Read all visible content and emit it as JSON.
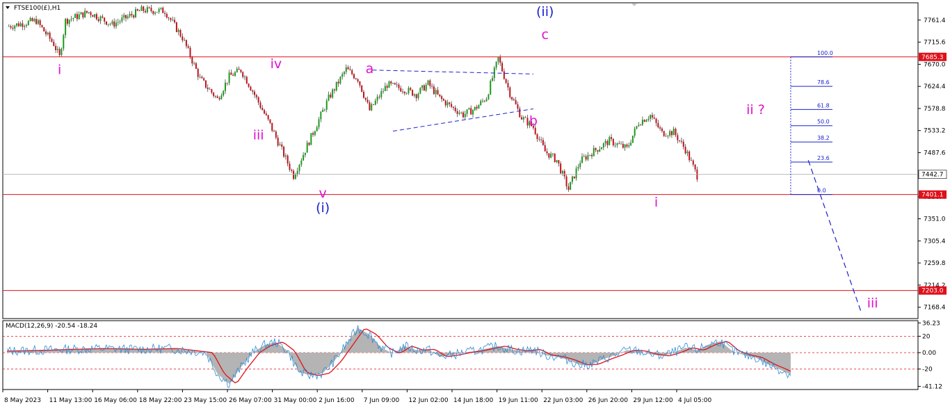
{
  "header": {
    "symbol": "FTSE100(£),H1",
    "macd_label": "MACD(12,26,9) -20.54 -18.24"
  },
  "colors": {
    "bull": "#1a9a1a",
    "bear": "#c0101a",
    "wick": "#2a2a2a",
    "level": "#e0101a",
    "wave_minor": "#e010d0",
    "wave_major": "#1a22cc",
    "fib": "#1a22cc",
    "macd_hist": "#b4b4b4",
    "macd_signal": "#e0101a",
    "macd_line": "#2a8ad6",
    "grid_border": "#000000"
  },
  "chart_data": [
    {
      "type": "candlestick",
      "title": "FTSE100(£),H1",
      "ylim": [
        7145,
        7797
      ],
      "y_ticks": [
        7761.4,
        7715.6,
        7670.0,
        7624.4,
        7578.8,
        7533.2,
        7487.6,
        7442.0,
        7396.4,
        7351.0,
        7305.4,
        7259.8,
        7214.2,
        7168.4
      ],
      "x_ticks": [
        "8 May 2023",
        "11 May 13:00",
        "16 May 06:00",
        "18 May 22:00",
        "23 May 15:00",
        "26 May 07:00",
        "31 May 00:00",
        "2 Jun 16:00",
        "7 Jun 09:00",
        "12 Jun 02:00",
        "14 Jun 18:00",
        "19 Jun 11:00",
        "22 Jun 03:00",
        "26 Jun 20:00",
        "29 Jun 12:00",
        "4 Jul 05:00"
      ],
      "price_path": [
        [
          0,
          7748
        ],
        [
          5,
          7760
        ],
        [
          8,
          7712
        ],
        [
          9,
          7685
        ],
        [
          10,
          7760
        ],
        [
          14,
          7778
        ],
        [
          18,
          7752
        ],
        [
          23,
          7782
        ],
        [
          27,
          7780
        ],
        [
          30,
          7725
        ],
        [
          33,
          7640
        ],
        [
          36,
          7598
        ],
        [
          38,
          7645
        ],
        [
          40,
          7658
        ],
        [
          42,
          7615
        ],
        [
          45,
          7545
        ],
        [
          49,
          7440
        ],
        [
          52,
          7520
        ],
        [
          55,
          7600
        ],
        [
          58,
          7660
        ],
        [
          60,
          7640
        ],
        [
          62,
          7575
        ],
        [
          65,
          7628
        ],
        [
          68,
          7618
        ],
        [
          70,
          7608
        ],
        [
          72,
          7630
        ],
        [
          74,
          7600
        ],
        [
          76,
          7582
        ],
        [
          78,
          7566
        ],
        [
          80,
          7578
        ],
        [
          82,
          7602
        ],
        [
          84,
          7682
        ],
        [
          86,
          7610
        ],
        [
          88,
          7560
        ],
        [
          90,
          7540
        ],
        [
          92,
          7490
        ],
        [
          94,
          7472
        ],
        [
          96,
          7412
        ],
        [
          98,
          7470
        ],
        [
          100,
          7488
        ],
        [
          103,
          7512
        ],
        [
          106,
          7496
        ],
        [
          108,
          7550
        ],
        [
          110,
          7565
        ],
        [
          112,
          7528
        ],
        [
          114,
          7530
        ],
        [
          116,
          7494
        ],
        [
          118,
          7440
        ]
      ],
      "current_price": "7442.7",
      "levels": [
        "7685.3",
        "7401.1",
        "7203.0"
      ],
      "fib_levels": [
        {
          "label": "100.0",
          "value": 7685.3
        },
        {
          "label": "78.6",
          "value": 7624.5
        },
        {
          "label": "61.8",
          "value": 7576.7
        },
        {
          "label": "50.0",
          "value": 7543.2
        },
        {
          "label": "38.2",
          "value": 7509.6
        },
        {
          "label": "23.6",
          "value": 7468.2
        },
        {
          "label": "0.0",
          "value": 7401.1
        }
      ],
      "wave_labels": [
        {
          "text": "i",
          "x": 9,
          "y": 7650,
          "style": "minor"
        },
        {
          "text": "iii",
          "x": 43,
          "y": 7515,
          "style": "minor"
        },
        {
          "text": "iv",
          "x": 46,
          "y": 7662,
          "style": "minor"
        },
        {
          "text": "v",
          "x": 54,
          "y": 7395,
          "style": "minor"
        },
        {
          "text": "(i)",
          "x": 54,
          "y": 7365,
          "style": "major"
        },
        {
          "text": "a",
          "x": 62,
          "y": 7652,
          "style": "minor"
        },
        {
          "text": "b",
          "x": 90,
          "y": 7544,
          "style": "minor"
        },
        {
          "text": "(ii)",
          "x": 92,
          "y": 7770,
          "style": "major"
        },
        {
          "text": "c",
          "x": 92,
          "y": 7722,
          "style": "minor"
        },
        {
          "text": "i",
          "x": 111,
          "y": 7376,
          "style": "minor"
        },
        {
          "text": "ii ?",
          "x": 128,
          "y": 7567,
          "style": "minor"
        },
        {
          "text": "iii",
          "x": 148,
          "y": 7168,
          "style": "minor"
        }
      ],
      "projection": [
        [
          137,
          7472
        ],
        [
          146,
          7160
        ]
      ]
    },
    {
      "type": "macd",
      "title": "MACD(12,26,9) -20.54 -18.24",
      "ylim": [
        -45,
        39
      ],
      "y_ticks": [
        "36.23",
        "20",
        "0.00",
        "-20",
        "-41.12"
      ],
      "dashed_levels": [
        20,
        0,
        -20
      ],
      "macd_path": [
        [
          0,
          2
        ],
        [
          6,
          3
        ],
        [
          10,
          4
        ],
        [
          16,
          5
        ],
        [
          22,
          4
        ],
        [
          28,
          5
        ],
        [
          34,
          0
        ],
        [
          36,
          -26
        ],
        [
          38,
          -38
        ],
        [
          40,
          -18
        ],
        [
          42,
          0
        ],
        [
          44,
          9
        ],
        [
          46,
          13
        ],
        [
          48,
          2
        ],
        [
          50,
          -24
        ],
        [
          52,
          -28
        ],
        [
          54,
          -25
        ],
        [
          56,
          -10
        ],
        [
          58,
          10
        ],
        [
          60,
          30
        ],
        [
          62,
          22
        ],
        [
          64,
          6
        ],
        [
          66,
          -1
        ],
        [
          68,
          8
        ],
        [
          70,
          3
        ],
        [
          72,
          4
        ],
        [
          74,
          -5
        ],
        [
          76,
          -3
        ],
        [
          78,
          0
        ],
        [
          80,
          2
        ],
        [
          82,
          5
        ],
        [
          84,
          8
        ],
        [
          86,
          4
        ],
        [
          88,
          2
        ],
        [
          90,
          4
        ],
        [
          92,
          -3
        ],
        [
          94,
          -5
        ],
        [
          96,
          -9
        ],
        [
          98,
          -15
        ],
        [
          100,
          -14
        ],
        [
          102,
          -8
        ],
        [
          104,
          -3
        ],
        [
          106,
          3
        ],
        [
          108,
          2
        ],
        [
          110,
          -2
        ],
        [
          112,
          -4
        ],
        [
          114,
          0
        ],
        [
          116,
          6
        ],
        [
          118,
          3
        ],
        [
          120,
          10
        ],
        [
          122,
          14
        ],
        [
          124,
          2
        ],
        [
          126,
          -3
        ],
        [
          128,
          -6
        ],
        [
          130,
          -14
        ],
        [
          132,
          -20
        ],
        [
          134,
          -27
        ]
      ]
    }
  ]
}
